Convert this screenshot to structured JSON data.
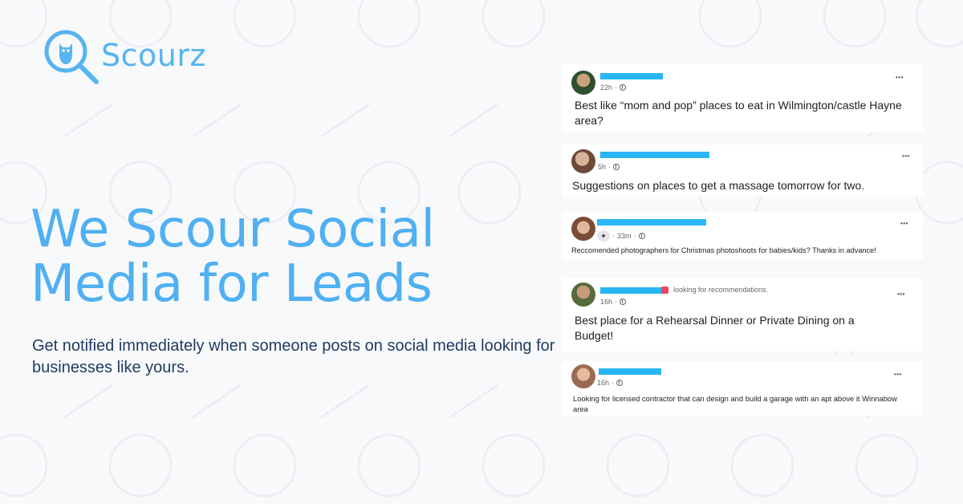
{
  "brand": {
    "name": "Scourz",
    "color": "#56b4f0"
  },
  "headline": {
    "line1": "We Scour Social",
    "line2": "Media for Leads"
  },
  "subtext": "Get notified immediately when someone posts on social media looking for businesses like yours.",
  "posts": [
    {
      "time": "22h",
      "text": "Best like “mom and pop” places to eat in Wilmington/castle Hayne area?"
    },
    {
      "time": "5h",
      "text": "Suggestions on places to get a massage tomorrow for two."
    },
    {
      "time": "33m",
      "text": "Reccomended photographers for Christmas photoshoots for babies/kids? Thanks in advance!"
    },
    {
      "time": "16h",
      "context": "looking for recommendations.",
      "text": "Best place for a Rehearsal Dinner or Private Dining on a Budget!"
    },
    {
      "time": "16h",
      "text": "Looking for licensed contractor that can design and build a garage with an apt above it Winnabow area"
    }
  ],
  "ui": {
    "more_label": "•••",
    "meta_sep": "·"
  },
  "colors": {
    "redaction": "#29b6f6",
    "headline": "#4fb0f2",
    "subtext": "#1f3a5f"
  }
}
